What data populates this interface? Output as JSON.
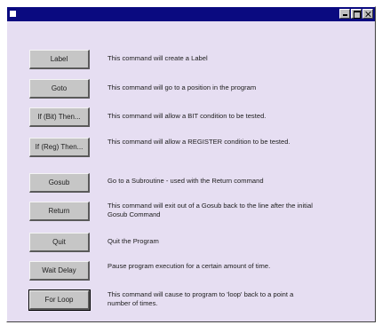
{
  "window": {
    "title": ""
  },
  "commands": [
    {
      "label": "Label",
      "description": "This command will create a Label"
    },
    {
      "label": "Goto",
      "description": "This command will go to a position in the program"
    },
    {
      "label": "If (Bit) Then...",
      "description": "This command will allow a BIT condition to be tested."
    },
    {
      "label": "If (Reg) Then...",
      "description": "This command will allow a REGISTER condition to be tested."
    },
    {
      "label": "Gosub",
      "description": "Go to a Subroutine - used with the Return command"
    },
    {
      "label": "Return",
      "description": "This command will exit out of a Gosub back to the line after the initial Gosub Command"
    },
    {
      "label": "Quit",
      "description": "Quit the Program"
    },
    {
      "label": "Wait Delay",
      "description": "Pause program execution for a certain amount of time."
    },
    {
      "label": "For Loop",
      "description": "This command will cause to program to 'loop' back to a point a number of times."
    }
  ]
}
